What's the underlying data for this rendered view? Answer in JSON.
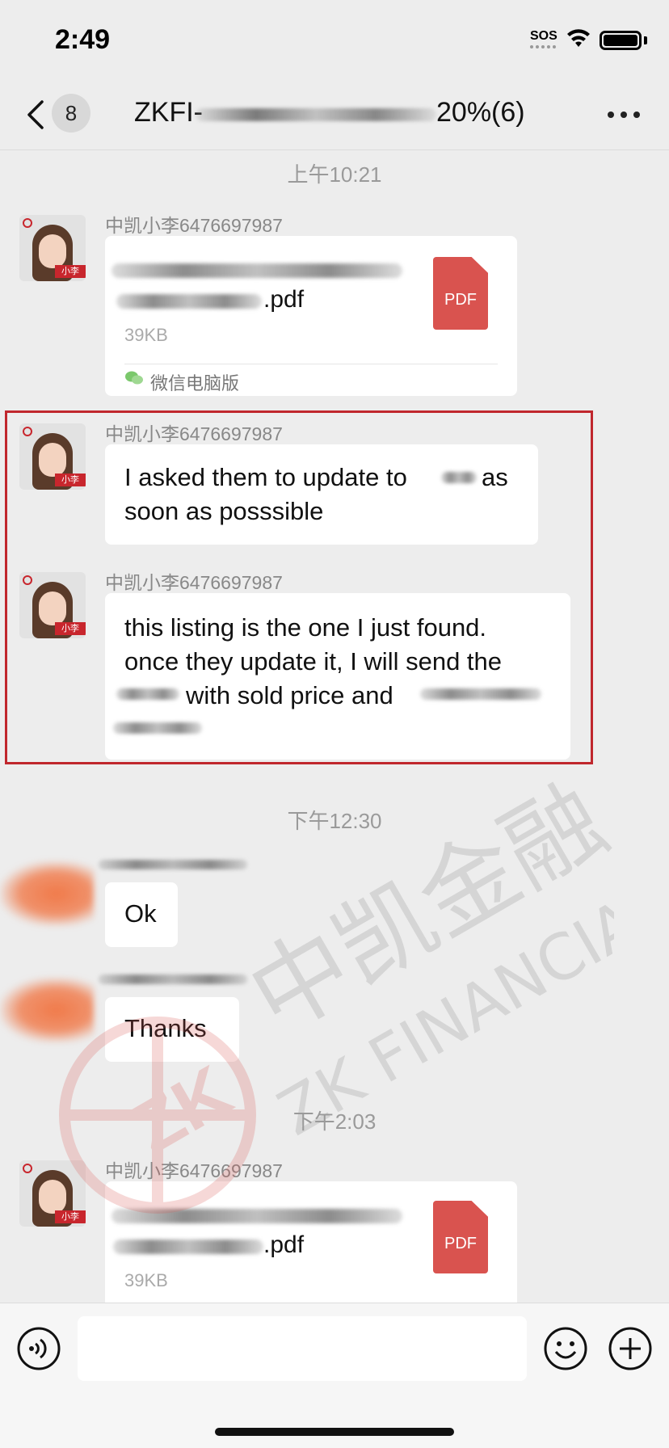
{
  "status_bar": {
    "time": "2:49",
    "sos": "SOS"
  },
  "nav": {
    "unread_count": "8",
    "title_prefix": "ZKFI-",
    "title_suffix": "20%(6)"
  },
  "timestamps": {
    "t1": "上午10:21",
    "t2": "下午12:30",
    "t3": "下午2:03"
  },
  "sender_name": "中凯小李6476697987",
  "avatar_tag": "小李",
  "messages": {
    "file1": {
      "ext": ".pdf",
      "size": "39KB",
      "icon": "PDF",
      "source": "微信电脑版"
    },
    "text1": {
      "line1": "I asked them to update to",
      "line1_end": "as",
      "line2": "soon as posssible"
    },
    "text2": {
      "line1": "this listing is the one I just found.",
      "line2": "once they update it, I will send the",
      "line3": "with sold price and"
    },
    "ok": "Ok",
    "thanks": "Thanks",
    "file2": {
      "ext": ".pdf",
      "size": "39KB",
      "icon": "PDF"
    }
  },
  "watermark": {
    "cn": "中凯金融",
    "en": "ZK FINANCIAL",
    "seal": "ZK"
  },
  "colors": {
    "highlight_border": "#c0272d",
    "pdf_red": "#d9534f",
    "background": "#ededed"
  }
}
